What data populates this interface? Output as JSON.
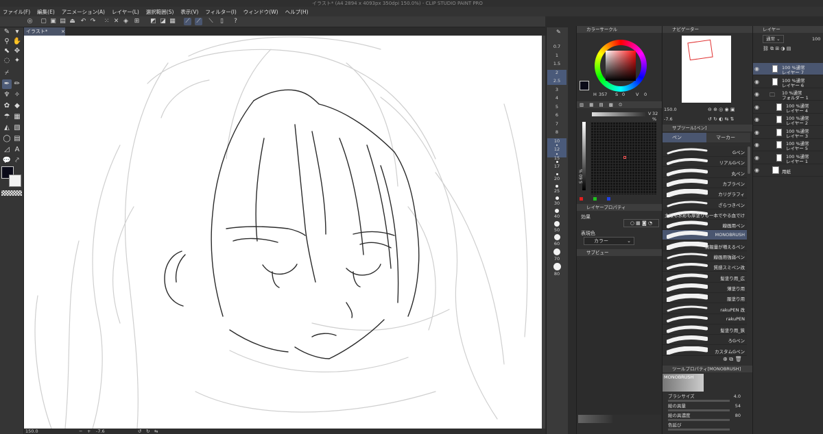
{
  "title": "イラスト* (A4 2894 x 4093px 350dpi 150.0%) - CLIP STUDIO PAINT PRO",
  "menu": [
    "ファイル(F)",
    "編集(E)",
    "アニメーション(A)",
    "レイヤー(L)",
    "選択範囲(S)",
    "表示(V)",
    "フィルター(I)",
    "ウィンドウ(W)",
    "ヘルプ(H)"
  ],
  "doc_tab": {
    "label": "イラスト*",
    "close": "×"
  },
  "status": {
    "zoom": "150.0",
    "angle": "-7.6"
  },
  "brush_sizes": [
    "0.7",
    "1",
    "1.5",
    "2",
    "2.5",
    "3",
    "4",
    "5",
    "6",
    "7",
    "8",
    "10",
    "12",
    "15",
    "17",
    "20",
    "25",
    "30",
    "40",
    "50",
    "60",
    "70",
    "80"
  ],
  "color_circle": {
    "tab_label": "カラーサークル",
    "h": "357",
    "s": "0",
    "v": "0"
  },
  "color_set": {
    "v_label": "V",
    "v_value": "32 %",
    "s_label": "S 60 %"
  },
  "layer_property": {
    "tab_label": "レイヤープロパティ",
    "effect_label": "効果",
    "expression_label": "表現色",
    "expression_value": "カラー"
  },
  "sub_view": {
    "tab_label": "サブビュー"
  },
  "navigator": {
    "tab_label": "ナビゲーター",
    "zoom": "150.0",
    "angle": "-7.6"
  },
  "sub_tool": {
    "tab_label": "サブツール[ペン]",
    "tabs": [
      "ペン",
      "マーカー"
    ],
    "items": [
      "Gペン",
      "リアルGペン",
      "丸ペン",
      "カブラペン",
      "カリグラフィ",
      "ざらつきペン",
      "主線も水彩も厚塗りも一本でやる血でけ",
      "線画用ペン",
      "MONOBRUSH",
      "情報量が増えるペン",
      "線画用強弱ペン",
      "質感スミペン改",
      "髪塗り用_広",
      "薄塗り用",
      "服塗り用",
      "rakuPEN 改",
      "rakuPEN",
      "髪塗り用_狭",
      "ろGペン",
      "カスタムGペン"
    ],
    "active_index": 8
  },
  "tool_property": {
    "tab_label": "ツールプロパティ[MONOBRUSH]",
    "brush_name": "MONOBRUSH",
    "rows": [
      {
        "label": "ブラシサイズ",
        "value": "4.0"
      },
      {
        "label": "絵の具量",
        "value": "54"
      },
      {
        "label": "絵の具濃度",
        "value": "80"
      },
      {
        "label": "色延び",
        "value": ""
      }
    ]
  },
  "layers": {
    "tab_label": "レイヤー",
    "blend_mode": "通常",
    "opacity": "100",
    "items": [
      {
        "line1": "100 %通常",
        "line2": "レイヤー 7",
        "active": true
      },
      {
        "line1": "100 %通常",
        "line2": "レイヤー 6",
        "active": false
      },
      {
        "line1": "10 %通常",
        "line2": "フォルダー 1",
        "active": false
      },
      {
        "line1": "100 %通常",
        "line2": "レイヤー 4",
        "active": false
      },
      {
        "line1": "100 %通常",
        "line2": "レイヤー 2",
        "active": false
      },
      {
        "line1": "100 %通常",
        "line2": "レイヤー 3",
        "active": false
      },
      {
        "line1": "100 %通常",
        "line2": "レイヤー 5",
        "active": false
      },
      {
        "line1": "100 %通常",
        "line2": "レイヤー 1",
        "active": false
      },
      {
        "line1": "用紙",
        "line2": "",
        "active": false
      }
    ]
  },
  "icons": [
    "pen-icon",
    "pencil-icon",
    "eraser-icon",
    "zoom-icon",
    "hand-icon",
    "lasso-icon",
    "eyedropper-icon",
    "bucket-icon",
    "gradient-icon",
    "text-icon",
    "undo-icon",
    "redo-icon",
    "eye-icon",
    "folder-icon"
  ]
}
